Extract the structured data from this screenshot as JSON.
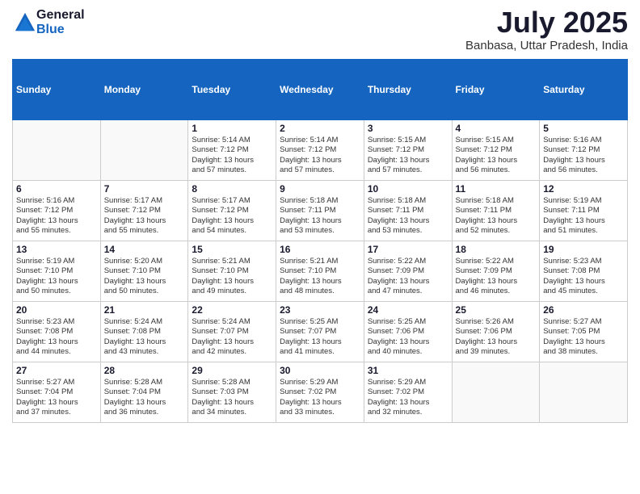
{
  "header": {
    "logo_general": "General",
    "logo_blue": "Blue",
    "title": "July 2025",
    "location": "Banbasa, Uttar Pradesh, India"
  },
  "calendar": {
    "weekdays": [
      "Sunday",
      "Monday",
      "Tuesday",
      "Wednesday",
      "Thursday",
      "Friday",
      "Saturday"
    ],
    "weeks": [
      [
        {
          "day": "",
          "info": ""
        },
        {
          "day": "",
          "info": ""
        },
        {
          "day": "1",
          "info": "Sunrise: 5:14 AM\nSunset: 7:12 PM\nDaylight: 13 hours\nand 57 minutes."
        },
        {
          "day": "2",
          "info": "Sunrise: 5:14 AM\nSunset: 7:12 PM\nDaylight: 13 hours\nand 57 minutes."
        },
        {
          "day": "3",
          "info": "Sunrise: 5:15 AM\nSunset: 7:12 PM\nDaylight: 13 hours\nand 57 minutes."
        },
        {
          "day": "4",
          "info": "Sunrise: 5:15 AM\nSunset: 7:12 PM\nDaylight: 13 hours\nand 56 minutes."
        },
        {
          "day": "5",
          "info": "Sunrise: 5:16 AM\nSunset: 7:12 PM\nDaylight: 13 hours\nand 56 minutes."
        }
      ],
      [
        {
          "day": "6",
          "info": "Sunrise: 5:16 AM\nSunset: 7:12 PM\nDaylight: 13 hours\nand 55 minutes."
        },
        {
          "day": "7",
          "info": "Sunrise: 5:17 AM\nSunset: 7:12 PM\nDaylight: 13 hours\nand 55 minutes."
        },
        {
          "day": "8",
          "info": "Sunrise: 5:17 AM\nSunset: 7:12 PM\nDaylight: 13 hours\nand 54 minutes."
        },
        {
          "day": "9",
          "info": "Sunrise: 5:18 AM\nSunset: 7:11 PM\nDaylight: 13 hours\nand 53 minutes."
        },
        {
          "day": "10",
          "info": "Sunrise: 5:18 AM\nSunset: 7:11 PM\nDaylight: 13 hours\nand 53 minutes."
        },
        {
          "day": "11",
          "info": "Sunrise: 5:18 AM\nSunset: 7:11 PM\nDaylight: 13 hours\nand 52 minutes."
        },
        {
          "day": "12",
          "info": "Sunrise: 5:19 AM\nSunset: 7:11 PM\nDaylight: 13 hours\nand 51 minutes."
        }
      ],
      [
        {
          "day": "13",
          "info": "Sunrise: 5:19 AM\nSunset: 7:10 PM\nDaylight: 13 hours\nand 50 minutes."
        },
        {
          "day": "14",
          "info": "Sunrise: 5:20 AM\nSunset: 7:10 PM\nDaylight: 13 hours\nand 50 minutes."
        },
        {
          "day": "15",
          "info": "Sunrise: 5:21 AM\nSunset: 7:10 PM\nDaylight: 13 hours\nand 49 minutes."
        },
        {
          "day": "16",
          "info": "Sunrise: 5:21 AM\nSunset: 7:10 PM\nDaylight: 13 hours\nand 48 minutes."
        },
        {
          "day": "17",
          "info": "Sunrise: 5:22 AM\nSunset: 7:09 PM\nDaylight: 13 hours\nand 47 minutes."
        },
        {
          "day": "18",
          "info": "Sunrise: 5:22 AM\nSunset: 7:09 PM\nDaylight: 13 hours\nand 46 minutes."
        },
        {
          "day": "19",
          "info": "Sunrise: 5:23 AM\nSunset: 7:08 PM\nDaylight: 13 hours\nand 45 minutes."
        }
      ],
      [
        {
          "day": "20",
          "info": "Sunrise: 5:23 AM\nSunset: 7:08 PM\nDaylight: 13 hours\nand 44 minutes."
        },
        {
          "day": "21",
          "info": "Sunrise: 5:24 AM\nSunset: 7:08 PM\nDaylight: 13 hours\nand 43 minutes."
        },
        {
          "day": "22",
          "info": "Sunrise: 5:24 AM\nSunset: 7:07 PM\nDaylight: 13 hours\nand 42 minutes."
        },
        {
          "day": "23",
          "info": "Sunrise: 5:25 AM\nSunset: 7:07 PM\nDaylight: 13 hours\nand 41 minutes."
        },
        {
          "day": "24",
          "info": "Sunrise: 5:25 AM\nSunset: 7:06 PM\nDaylight: 13 hours\nand 40 minutes."
        },
        {
          "day": "25",
          "info": "Sunrise: 5:26 AM\nSunset: 7:06 PM\nDaylight: 13 hours\nand 39 minutes."
        },
        {
          "day": "26",
          "info": "Sunrise: 5:27 AM\nSunset: 7:05 PM\nDaylight: 13 hours\nand 38 minutes."
        }
      ],
      [
        {
          "day": "27",
          "info": "Sunrise: 5:27 AM\nSunset: 7:04 PM\nDaylight: 13 hours\nand 37 minutes."
        },
        {
          "day": "28",
          "info": "Sunrise: 5:28 AM\nSunset: 7:04 PM\nDaylight: 13 hours\nand 36 minutes."
        },
        {
          "day": "29",
          "info": "Sunrise: 5:28 AM\nSunset: 7:03 PM\nDaylight: 13 hours\nand 34 minutes."
        },
        {
          "day": "30",
          "info": "Sunrise: 5:29 AM\nSunset: 7:02 PM\nDaylight: 13 hours\nand 33 minutes."
        },
        {
          "day": "31",
          "info": "Sunrise: 5:29 AM\nSunset: 7:02 PM\nDaylight: 13 hours\nand 32 minutes."
        },
        {
          "day": "",
          "info": ""
        },
        {
          "day": "",
          "info": ""
        }
      ]
    ]
  }
}
